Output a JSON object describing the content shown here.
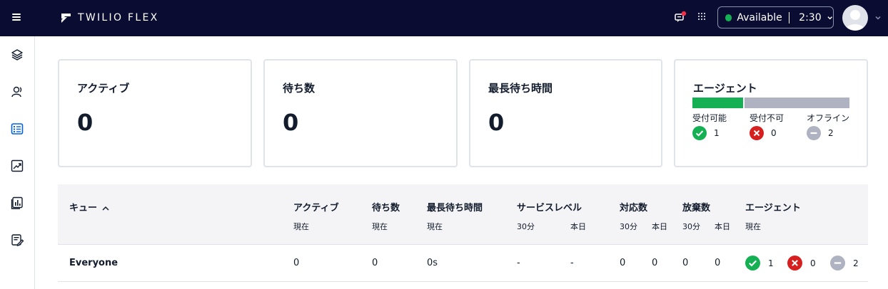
{
  "topbar": {
    "brand": "TWILIO FLEX",
    "status_label": "Available",
    "status_time": "2:30",
    "colors": {
      "background": "#0b0c32",
      "available": "#14b053",
      "notification": "#f22f46"
    }
  },
  "sidebar": {
    "icons": [
      "layers-icon",
      "contacts-icon",
      "queues-stats-icon",
      "analytics-icon",
      "dashboards-icon",
      "quality-icon"
    ],
    "active_index": 2
  },
  "cards": {
    "active": {
      "title": "アクティブ",
      "value": "0"
    },
    "waiting": {
      "title": "待ち数",
      "value": "0"
    },
    "longest": {
      "title": "最長待ち時間",
      "value": "0"
    },
    "agents": {
      "title": "エージェント",
      "bar": {
        "available_fraction": 0.333,
        "unavailable_fraction": 0.0,
        "offline_fraction": 0.667
      },
      "available": {
        "label": "受付可能",
        "count": "1"
      },
      "unavailable": {
        "label": "受付不可",
        "count": "0"
      },
      "offline": {
        "label": "オフライン",
        "count": "2"
      }
    }
  },
  "table": {
    "headers": {
      "queue": "キュー",
      "active": "アクティブ",
      "waiting": "待ち数",
      "longest": "最長待ち時間",
      "service_level": "サービスレベル",
      "handled": "対応数",
      "abandoned": "放棄数",
      "agents": "エージェント"
    },
    "subheaders": {
      "current": "現在",
      "thirty_min": "30分",
      "today": "本日"
    },
    "rows": [
      {
        "queue": "Everyone",
        "active": "0",
        "waiting": "0",
        "longest": "0s",
        "sl_30": "-",
        "sl_today": "-",
        "handled_30": "0",
        "handled_today": "0",
        "abandoned_30": "0",
        "abandoned_today": "0",
        "agents_available": "1",
        "agents_unavailable": "0",
        "agents_offline": "2"
      }
    ]
  },
  "colors": {
    "available": "#14b053",
    "unavailable": "#d61f1f",
    "offline": "#aeb2c1",
    "active_nav": "#0263e0"
  }
}
